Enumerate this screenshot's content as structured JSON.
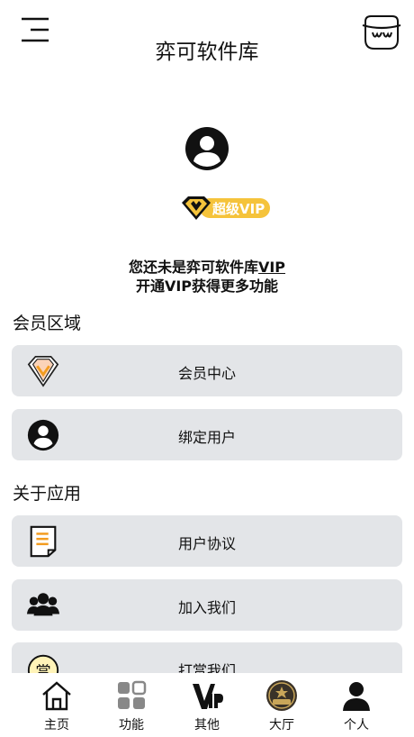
{
  "header": {
    "title": "弈可软件库"
  },
  "profile": {
    "vip_badge_label": "超级VIP",
    "notice_line1_prefix": "您还未是弈可软件库",
    "notice_line1_link": "VIP",
    "notice_line2": "开通VIP获得更多功能"
  },
  "sections": {
    "member": {
      "title": "会员区域",
      "items": [
        {
          "label": "会员中心",
          "icon": "vip-diamond-icon"
        },
        {
          "label": "绑定用户",
          "icon": "user-circle-icon"
        }
      ]
    },
    "about": {
      "title": "关于应用",
      "items": [
        {
          "label": "用户协议",
          "icon": "document-icon"
        },
        {
          "label": "加入我们",
          "icon": "group-icon"
        },
        {
          "label": "打赏我们",
          "icon": "reward-icon"
        }
      ],
      "reward_glyph": "赏"
    }
  },
  "tabbar": {
    "items": [
      {
        "label": "主页",
        "icon": "home-icon"
      },
      {
        "label": "功能",
        "icon": "grid-icon"
      },
      {
        "label": "其他",
        "icon": "vip-letter-icon"
      },
      {
        "label": "大厅",
        "icon": "vip-medal-icon"
      },
      {
        "label": "个人",
        "icon": "person-icon"
      }
    ]
  },
  "colors": {
    "card_bg": "#e3e5e8",
    "vip_gold": "#f5c33b",
    "accent_orange": "#f39c1f"
  }
}
